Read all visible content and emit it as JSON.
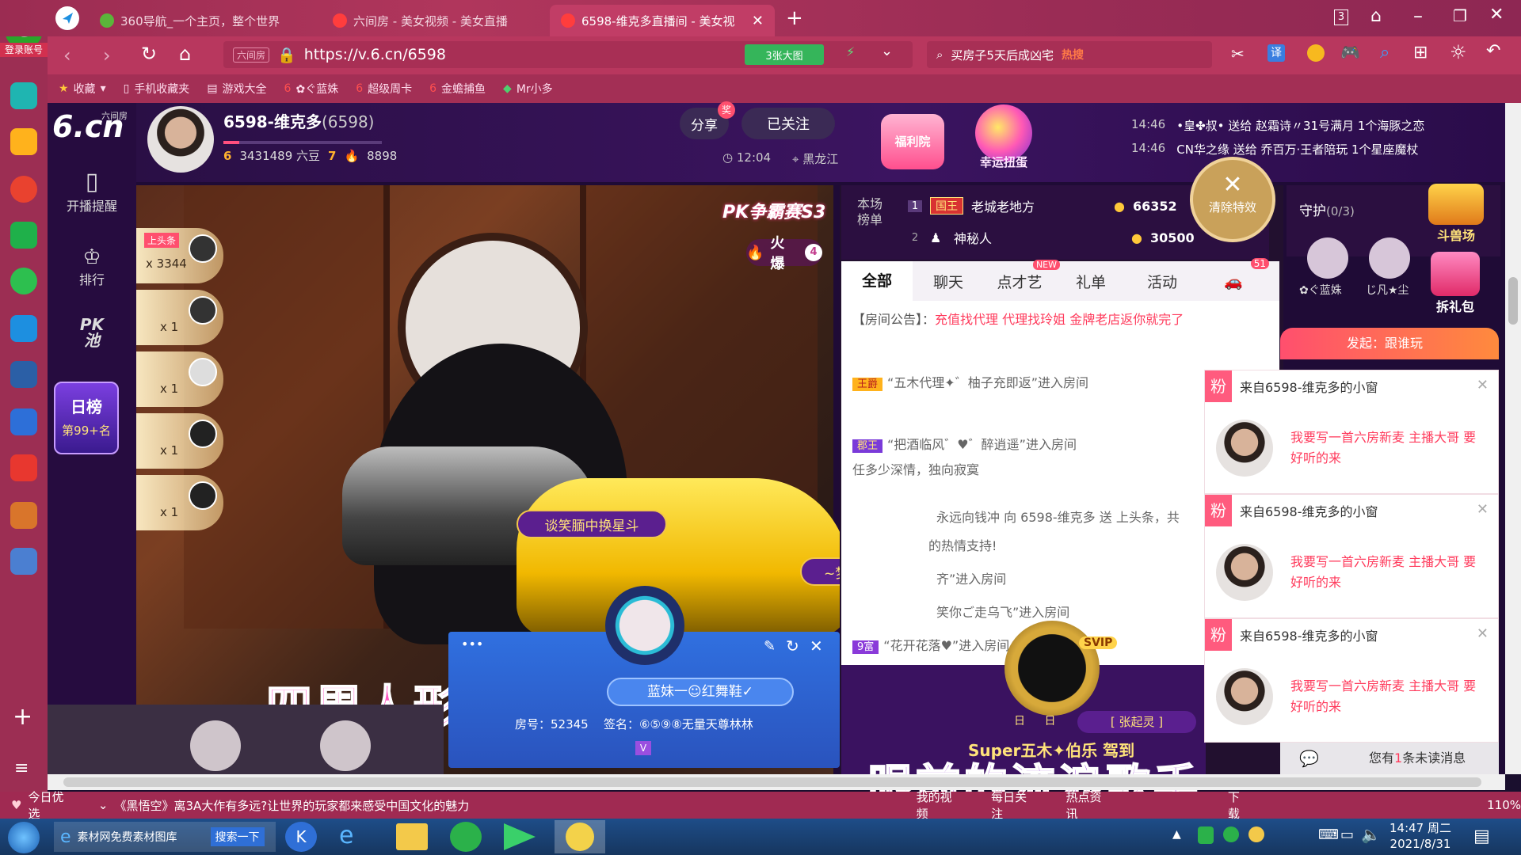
{
  "browser": {
    "tabs": [
      {
        "label": "360导航_一个主页，整个世界",
        "active": false,
        "icon": "360-icon"
      },
      {
        "label": "六间房 - 美女视频 - 美女直播",
        "active": false,
        "icon": "6cn-icon"
      },
      {
        "label": "6598-维克多直播间 - 美女视",
        "active": true,
        "icon": "6cn-icon"
      }
    ],
    "window_counter": "3",
    "url": "https://v.6.cn/6598",
    "url_site_tag": "六间房",
    "images_badge": "3张大图",
    "search_text": "买房子5天后成凶宅",
    "search_hot": "热搜",
    "login_label": "登录账号",
    "translate_label": "译",
    "bookmarks": [
      {
        "label": "收藏",
        "icon": "star-icon"
      },
      {
        "label": "手机收藏夹",
        "icon": "phone-icon"
      },
      {
        "label": "游戏大全",
        "icon": "doc-icon"
      },
      {
        "label": "✿ぐ蓝姝",
        "icon": "6cn-icon"
      },
      {
        "label": "超级周卡",
        "icon": "6cn-icon"
      },
      {
        "label": "金蟾捕鱼",
        "icon": "6cn-icon"
      },
      {
        "label": "Mr小多",
        "icon": "green-icon"
      }
    ]
  },
  "site": {
    "logo": "6.cn",
    "logo_sub": "六间房",
    "nav": [
      {
        "label": "开播提醒",
        "icon": "phone-icon"
      },
      {
        "label": "排行",
        "icon": "crown-icon"
      },
      {
        "label": "PK池",
        "icon": "pk-icon"
      }
    ],
    "daily_rank_title": "日榜",
    "daily_rank_value": "第99+名"
  },
  "anchor": {
    "name": "6598-维克多",
    "room_id": "(6598)",
    "level_left": "6",
    "beans": "3431489 六豆",
    "level_right": "7",
    "fans": "8898",
    "share_label": "分享",
    "share_badge": "奖",
    "follow_label": "已关注",
    "time": "12:04",
    "location": "黑龙江"
  },
  "banner": {
    "welfare_label": "福利院",
    "lucky_label": "幸运扭蛋",
    "gift_feed": [
      {
        "time": "14:46",
        "text": "•皇✤叔• 送给 赵霜诗〃31号满月 1个海豚之恋"
      },
      {
        "time": "14:46",
        "text": "CN华之缘 送给 乔百万·王者陪玩 1个星座魔杖"
      }
    ]
  },
  "video": {
    "pk_badge": "PK争霸赛S3",
    "hot_label": "火爆",
    "hot_count": "4",
    "gift_rows": [
      {
        "label": "上头条",
        "count": "x 3344"
      },
      {
        "count": "x 1"
      },
      {
        "count": "x 1"
      },
      {
        "count": "x 1"
      },
      {
        "count": "x 1"
      }
    ],
    "car_label_1": "谈笑腼中换星斗",
    "car_label_2": "~梦✦想~扬帆♥起航",
    "overlay_big_1": "四周人形态万千",
    "overlay_big_2": "眼前的流浪歌手"
  },
  "user_card": {
    "menu_dots": "•••",
    "name": "蓝妹一☺红舞鞋✓",
    "room_label": "房号：52345",
    "sign_label": "签名：⑥⑤⑨⑧无量天尊林林",
    "vip_badge": "V"
  },
  "ranking": {
    "title_line1": "本场",
    "title_line2": "榜单",
    "rows": [
      {
        "rank": "1",
        "badge": "国王",
        "name": "老城老地方",
        "coins": "66352"
      },
      {
        "rank": "2",
        "badge": "",
        "name": "神秘人",
        "coins": "30500"
      }
    ],
    "clear_effects": "清除特效"
  },
  "chat": {
    "tabs": [
      "全部",
      "聊天",
      "点才艺",
      "礼单",
      "活动"
    ],
    "new_badge": "NEW",
    "car_count": "51",
    "notice_label": "【房间公告】：",
    "notice_text": "充值找代理 代理找玲姐 金牌老店返你就完了",
    "messages": [
      {
        "badge": "王爵",
        "text": "“五木代理✦゛柚子充即返”进入房间"
      },
      {
        "badge": "郡王",
        "text": "“把酒临风゛♥゛醉逍遥”进入房间"
      },
      {
        "badge": "",
        "text": "任多少深情，独向寂寞"
      },
      {
        "badge": "",
        "text": "永远向钱冲 向 6598-维克多 送 上头条，共"
      },
      {
        "badge": "",
        "text": "的热情支持!"
      },
      {
        "badge": "",
        "text": "齐”进入房间"
      },
      {
        "badge": "",
        "text": "笑你ご走乌飞”进入房间"
      },
      {
        "badge": "9富",
        "text": "“花开花落♥”进入房间"
      }
    ],
    "svip_badge": "SVIP",
    "entrant_name": "[ 张起灵 ]",
    "entrant_text": "Super五木✦伯乐 驾到",
    "entrant_plate": "日 日"
  },
  "guard": {
    "title": "守护",
    "count": "(0/3)",
    "members": [
      "✿ぐ蓝姝",
      "じ凡★尘"
    ],
    "arena_label": "斗兽场",
    "gift_label": "拆礼包",
    "launch_label": "发起：跟谁玩"
  },
  "notifications": [
    {
      "badge": "粉",
      "from": "来自6598-维克多的小窗",
      "text": "我要写一首六房新麦 主播大哥 要好听的来"
    },
    {
      "badge": "粉",
      "from": "来自6598-维克多的小窗",
      "text": "我要写一首六房新麦 主播大哥 要好听的来"
    },
    {
      "badge": "粉",
      "from": "来自6598-维克多的小窗",
      "text": "我要写一首六房新麦 主播大哥 要好听的来"
    }
  ],
  "unread": {
    "prefix": "您有",
    "count": "1",
    "suffix": "条未读消息"
  },
  "status": {
    "today": "今日优选",
    "headline": "《黑悟空》离3A大作有多远?让世界的玩家都来感受中国文化的魅力",
    "items": [
      "我的视频",
      "每日关注",
      "热点资讯",
      "下载"
    ],
    "zoom": "110%"
  },
  "taskbar": {
    "items": [
      {
        "label": "素材网免费素材图库",
        "icon": "ie-icon"
      },
      {
        "label": "搜索一下",
        "icon": "search-icon"
      }
    ],
    "time": "14:47 周二",
    "date": "2021/8/31"
  },
  "colors": {
    "accent": "#b0365c",
    "chat_red": "#ff3b5c",
    "gold": "#f5c23a"
  }
}
